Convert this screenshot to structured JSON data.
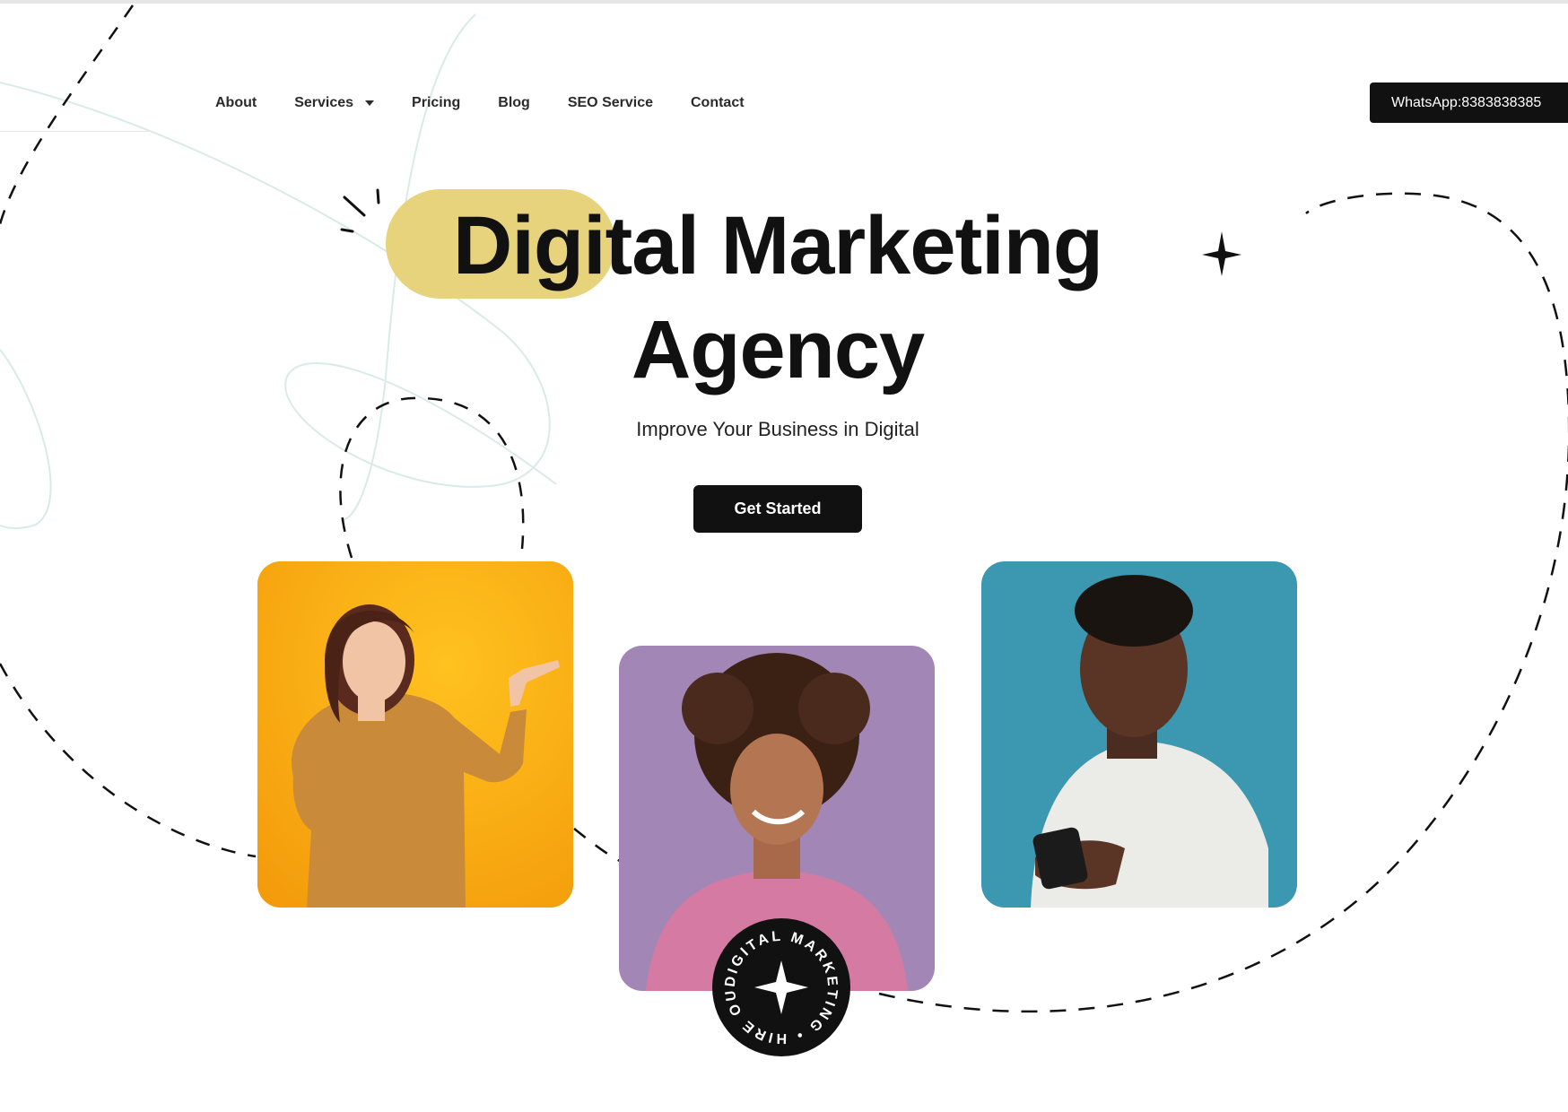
{
  "nav": {
    "items": [
      {
        "label": "About"
      },
      {
        "label": "Services",
        "has_dropdown": true
      },
      {
        "label": "Pricing"
      },
      {
        "label": "Blog"
      },
      {
        "label": "SEO Service"
      },
      {
        "label": "Contact"
      }
    ],
    "whatsapp_label": "WhatsApp:8383838385"
  },
  "hero": {
    "title_line1": "Digital Marketing",
    "title_line2": "Agency",
    "subtitle": "Improve Your Business in Digital",
    "cta_label": "Get Started"
  },
  "badge": {
    "ring_text": "DIGITAL MARKETING • HIRE OUR "
  },
  "images": [
    {
      "name": "woman-pointing-photo",
      "background": "#f6ae12"
    },
    {
      "name": "woman-smiling-photo",
      "background": "#a287b6"
    },
    {
      "name": "man-with-phone-photo",
      "background": "#3c98b0"
    }
  ],
  "colors": {
    "accent_highlight": "#e6d37c",
    "button_dark": "#111111"
  }
}
